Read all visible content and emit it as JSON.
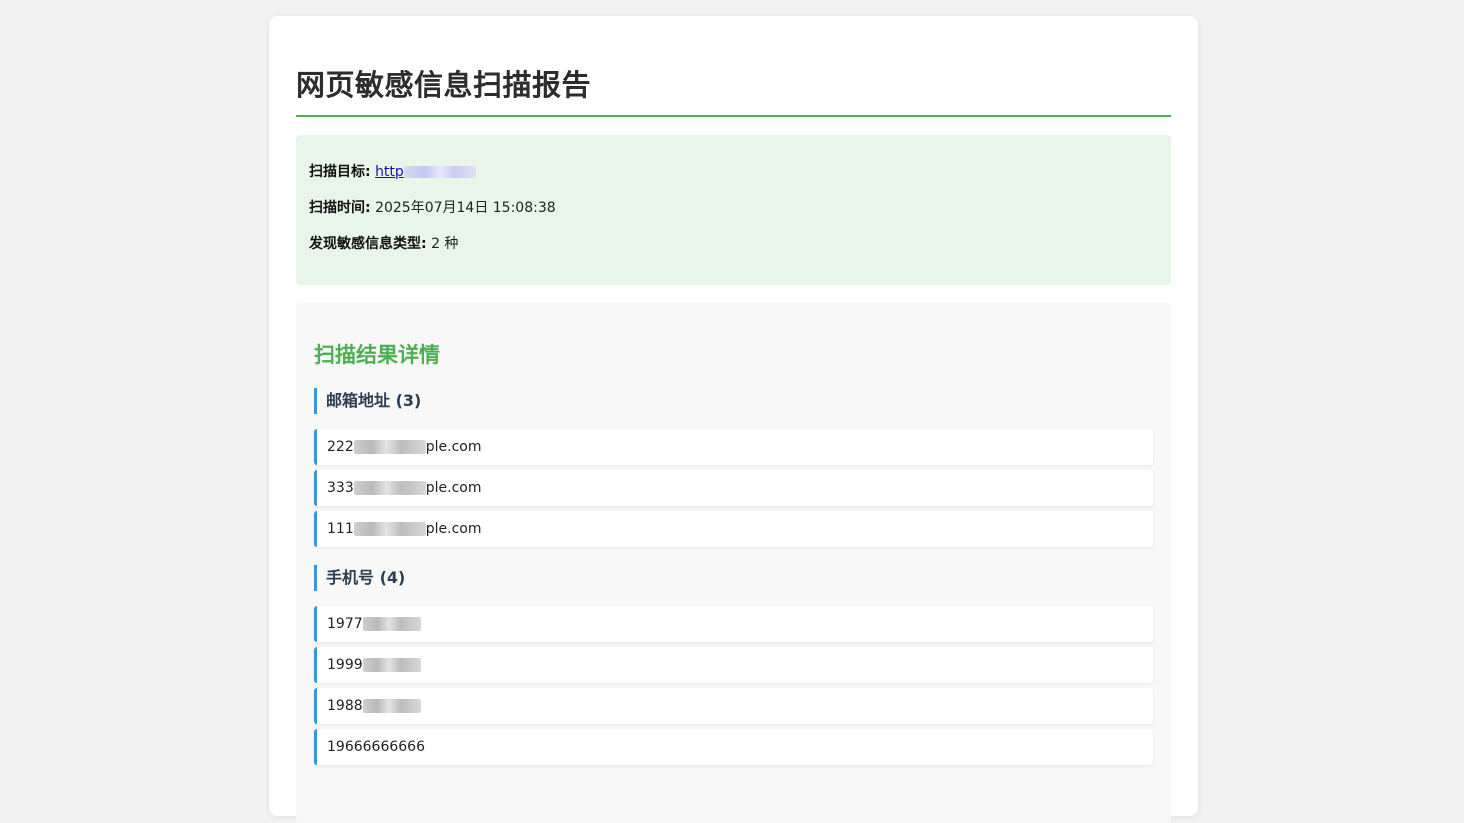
{
  "report": {
    "title": "网页敏感信息扫描报告",
    "colors": {
      "accent_green": "#4caf50",
      "summary_bg": "#e8f5e9",
      "item_border_blue": "#3498db"
    }
  },
  "summary": {
    "target_label": "扫描目标:",
    "target_value": "http",
    "time_label": "扫描时间:",
    "time_value": "2025年07月14日 15:08:38",
    "types_label": "发现敏感信息类型:",
    "types_value": "2 种"
  },
  "details": {
    "title": "扫描结果详情",
    "categories": [
      {
        "label": "邮箱地址 (3)",
        "items": [
          {
            "prefix": "222",
            "suffix": "ple.com"
          },
          {
            "prefix": "333",
            "suffix": "ple.com"
          },
          {
            "prefix": "111",
            "suffix": "ple.com"
          }
        ]
      },
      {
        "label": "手机号 (4)",
        "items": [
          {
            "prefix": "1977",
            "suffix": ""
          },
          {
            "prefix": "1999",
            "suffix": ""
          },
          {
            "prefix": "1988",
            "suffix": ""
          },
          {
            "prefix": "19666666666",
            "suffix": ""
          }
        ]
      }
    ]
  }
}
